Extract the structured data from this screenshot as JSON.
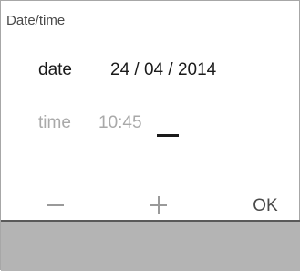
{
  "header": {
    "title": "Date/time"
  },
  "date_row": {
    "label": "date",
    "value": "24 / 04 / 2014"
  },
  "time_row": {
    "label": "time",
    "value": "10:45"
  },
  "controls": {
    "minus_icon": "minus-icon",
    "plus_icon": "plus-icon",
    "ok_label": "OK"
  },
  "colors": {
    "active_text": "#1a1a1a",
    "inactive_text": "#a9a9a9",
    "icon_gray": "#9a9a9a",
    "divider": "#5a5a5a",
    "bottom_panel": "#b4b4b4"
  }
}
